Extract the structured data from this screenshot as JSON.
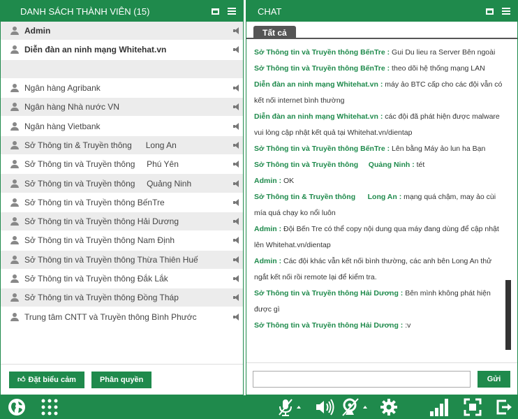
{
  "members_panel": {
    "title": "DANH SÁCH THÀNH VIÊN (15)",
    "members": [
      {
        "name": "Admin",
        "bold": true
      },
      {
        "name": "Diễn đàn an ninh mạng Whitehat.vn",
        "bold": true,
        "tall": true
      },
      {
        "name": "Ngân hàng Agribank"
      },
      {
        "name": "Ngân hàng Nhà nước VN"
      },
      {
        "name": "Ngân hàng Vietbank"
      },
      {
        "name": "Sở Thông tin & Truyền thông      Long An"
      },
      {
        "name": "Sở Thông tin và Truyền thông     Phú Yên"
      },
      {
        "name": "Sở Thông tin và Truyền thông     Quảng Ninh"
      },
      {
        "name": "Sở Thông tin và Truyền thông BếnTre"
      },
      {
        "name": "Sở Thông tin và Truyền thông Hải Dương"
      },
      {
        "name": "Sở Thông tin và Truyền thông Nam Định"
      },
      {
        "name": "Sở Thông tin và Truyền thông Thừa Thiên Huế"
      },
      {
        "name": "Sở Thông tin và Truyền thông Đắk Lắk"
      },
      {
        "name": "Sở Thông tin và Truyền thông Đồng Tháp"
      },
      {
        "name": "Trung tâm CNTT và Truyền thông Bình Phước"
      }
    ],
    "emoji_button": "Đặt biểu cảm",
    "permission_button": "Phân quyền"
  },
  "chat_panel": {
    "title": "CHAT",
    "tab_all": "Tất cả",
    "messages": [
      {
        "sender": "Sở Thông tin và Truyền thông BếnTre :",
        "text": " Gui Du lieu ra Server Bên ngoài"
      },
      {
        "sender": "Sở Thông tin và Truyền thông BếnTre :",
        "text": " theo dõi hệ thống mạng LAN"
      },
      {
        "sender": "Diễn đàn an ninh mạng Whitehat.vn :",
        "text": " máy ảo BTC cấp cho các đội vẫn có kết nối internet bình thường"
      },
      {
        "sender": "Diễn đàn an ninh mạng Whitehat.vn :",
        "text": " các đội đã phát hiện được malware vui lòng cập nhật kết quả tại Whitehat.vn/dientap"
      },
      {
        "sender": "Sở Thông tin và Truyền thông BếnTre :",
        "text": " Lên bằng Máy ảo lun ha Bạn"
      },
      {
        "sender": "Sở Thông tin và Truyền thông     Quảng Ninh :",
        "text": " tét"
      },
      {
        "sender": "Admin :",
        "text": " OK"
      },
      {
        "sender": "Sở Thông tin & Truyền thông      Long An :",
        "text": " mạng quá chậm, may ảo cùi mía quá chạy ko nổi luôn"
      },
      {
        "sender": "Admin :",
        "text": " Đội Bến Tre có thể copy nội dung qua máy đang dùng để cập nhật lên Whitehat.vn/dientap"
      },
      {
        "sender": "Admin :",
        "text": " Các đội khác vẫn kết nối bình thường, các anh bên Long An thử ngắt kết nối rồi remote lại để kiểm tra."
      },
      {
        "sender": "Sở Thông tin và Truyền thông Hải Dương :",
        "text": " Bên mình không phát hiện được gì"
      },
      {
        "sender": "Sở Thông tin và Truyền thông Hải Dương :",
        "text": " :v"
      }
    ],
    "input_value": "",
    "send_button": "Gửi"
  },
  "colors": {
    "accent": "#1f8a4c",
    "tab": "#555555"
  }
}
